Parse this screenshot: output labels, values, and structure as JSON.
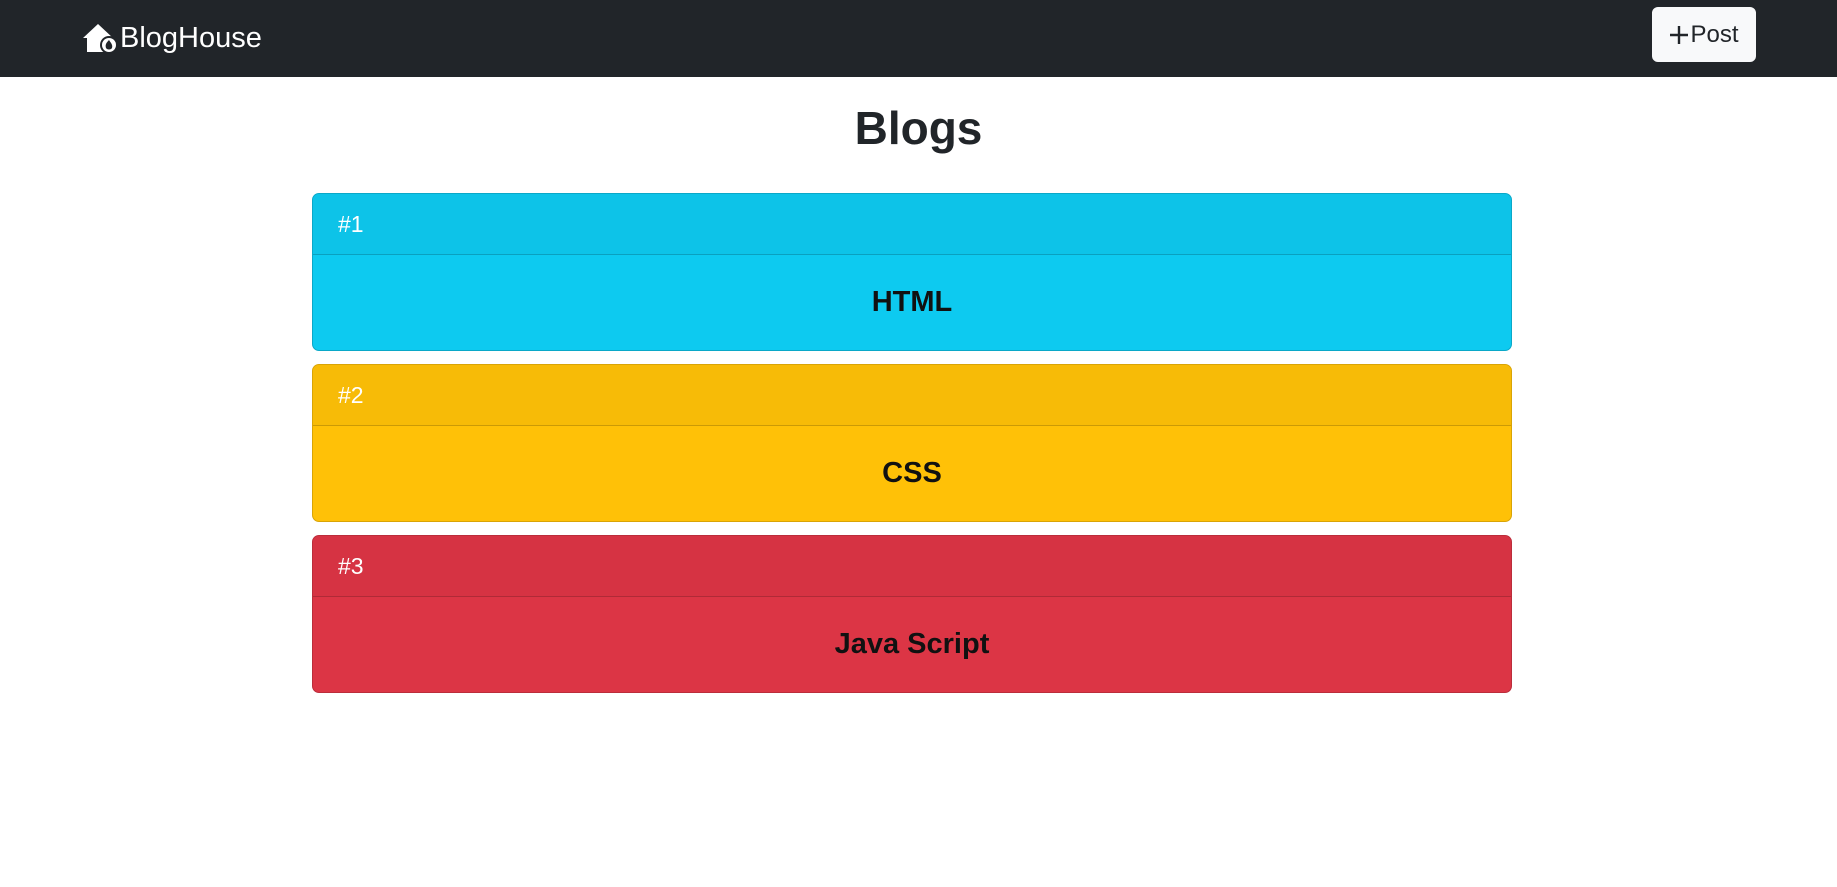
{
  "navbar": {
    "brand": "BlogHouse",
    "brand_icon": "house-fire-icon",
    "post_button_label": "Post",
    "post_button_icon": "plus-icon",
    "background": "#212529"
  },
  "page": {
    "title": "Blogs"
  },
  "blogs": [
    {
      "number": "#1",
      "title": "HTML",
      "color": "#0dcaf0",
      "header_color": "#0dc3e8",
      "border": "#0aa8c8"
    },
    {
      "number": "#2",
      "title": "CSS",
      "color": "#ffc107",
      "header_color": "#f7bb07",
      "border": "#d9a406"
    },
    {
      "number": "#3",
      "title": "Java Script",
      "color": "#dc3545",
      "header_color": "#d63343",
      "border": "#bb2d3b"
    }
  ]
}
